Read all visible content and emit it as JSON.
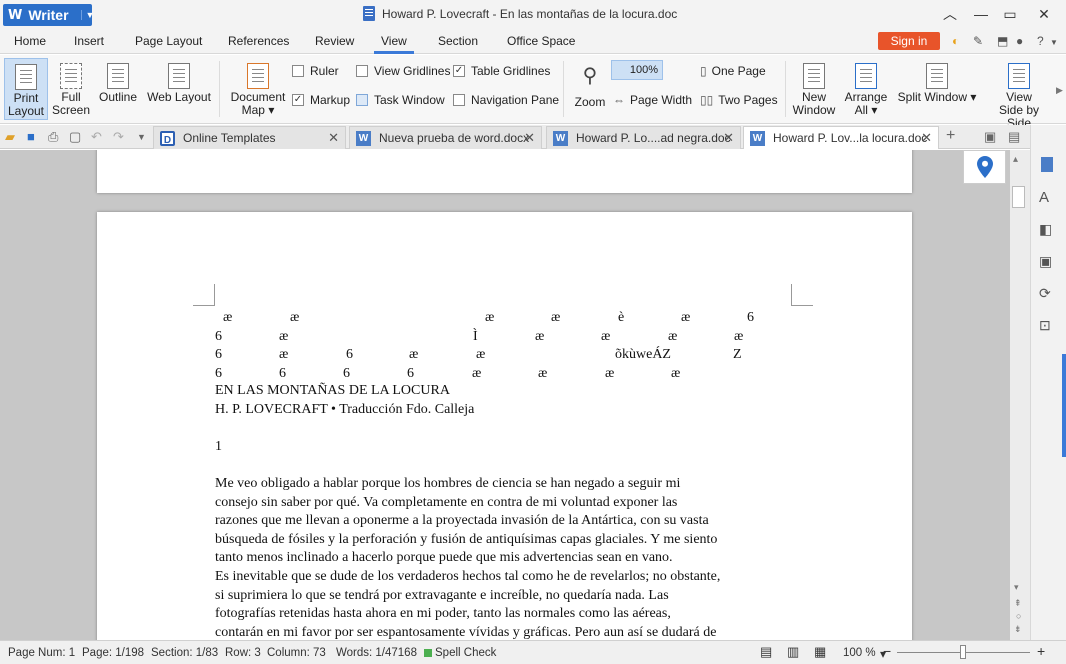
{
  "app": {
    "name": "Writer",
    "window_title": "Howard P. Lovecraft - En las montañas de la locura.doc"
  },
  "menu": {
    "tabs": [
      "Home",
      "Insert",
      "Page Layout",
      "References",
      "Review",
      "View",
      "Section",
      "Office Space"
    ],
    "active": "View",
    "signin_label": "Sign in"
  },
  "ribbon": {
    "print_layout": [
      "Print",
      "Layout"
    ],
    "full_screen": [
      "Full",
      "Screen"
    ],
    "outline": "Outline",
    "web_layout": "Web Layout",
    "document_map": [
      "Document",
      "Map"
    ],
    "ruler": "Ruler",
    "markup": "Markup",
    "view_gridlines": "View Gridlines",
    "task_window": "Task Window",
    "table_gridlines": "Table Gridlines",
    "navigation_pane": "Navigation Pane",
    "zoom": "Zoom",
    "zoom_value": "100%",
    "page_width": "Page Width",
    "one_page": "One Page",
    "two_pages": "Two Pages",
    "new_window": [
      "New",
      "Window"
    ],
    "arrange_all": [
      "Arrange",
      "All"
    ],
    "split_window": "Split Window",
    "view_side_by_side": [
      "View",
      "Side by Side"
    ],
    "checks": {
      "ruler": false,
      "markup": true,
      "view_gridlines": false,
      "task_window": false,
      "table_gridlines": true,
      "navigation_pane": false
    }
  },
  "doc_tabs": [
    {
      "label": "Online Templates",
      "active": false
    },
    {
      "label": "Nueva prueba de word.docx",
      "active": false
    },
    {
      "label": "Howard P. Lo....ad negra.doc",
      "active": false
    },
    {
      "label": "Howard P. Lov...la locura.doc",
      "active": true
    }
  ],
  "document": {
    "garbled_rows": [
      [
        "æ",
        "æ",
        "æ",
        "æ",
        "è",
        "æ",
        "6"
      ],
      [
        "6",
        "æ",
        "Ì",
        "æ",
        "æ",
        "æ",
        "æ"
      ],
      [
        "6",
        "æ",
        "6",
        "æ",
        "æ",
        "õkùweÁZ",
        "Z"
      ],
      [
        "6",
        "6",
        "6",
        "6",
        "æ",
        "æ",
        "æ",
        "æ"
      ]
    ],
    "title": "EN LAS MONTAÑAS DE LA LOCURA",
    "byline": "H. P. LOVECRAFT • Traducción Fdo. Calleja",
    "chapter": "1",
    "lines": [
      "Me veo obligado a hablar porque los hombres de ciencia se han negado a seguir mi",
      "consejo sin saber por qué. Va completamente en contra de mi voluntad exponer las",
      "razones que me llevan a oponerme a la proyectada invasión de la Antártica, con su vasta",
      "búsqueda de fósiles y la perforación y fusión de antiquísimas capas glaciales. Y me siento",
      "tanto menos inclinado a hacerlo porque puede que mis advertencias sean en vano.",
      "Es inevitable que se dude de los verdaderos hechos tal como he de revelarlos; no obstante,",
      "si suprimiera lo que se tendrá por extravagante e increíble, no quedaría nada. Las",
      "fotografías retenidas hasta ahora en mi poder, tanto las normales como las aéreas,",
      "contarán en mi favor por ser espantosamente vívidas y gráficas. Pero aun así se dudará de"
    ]
  },
  "status": {
    "page_num": "Page Num: 1",
    "page": "Page: 1/198",
    "section": "Section: 1/83",
    "row": "Row: 3",
    "column": "Column: 73",
    "words": "Words: 1/47168",
    "spell_check": "Spell Check",
    "zoom": "100 %",
    "zoom_level": 0.5
  },
  "colors": {
    "accent": "#3b7ad8",
    "signin": "#e8542a",
    "app_button": "#2b6fc9"
  }
}
